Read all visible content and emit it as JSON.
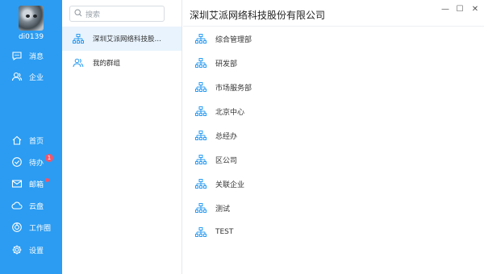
{
  "user": {
    "name": "di0139"
  },
  "nav_top": [
    {
      "label": "消息",
      "icon": "message-icon"
    },
    {
      "label": "企业",
      "icon": "contacts-icon"
    }
  ],
  "nav_bottom": [
    {
      "label": "首页",
      "icon": "home-icon"
    },
    {
      "label": "待办",
      "icon": "todo-icon",
      "badge": "1"
    },
    {
      "label": "邮箱",
      "icon": "mail-icon"
    },
    {
      "label": "云盘",
      "icon": "cloud-icon"
    },
    {
      "label": "工作圈",
      "icon": "work-circle-icon"
    },
    {
      "label": "设置",
      "icon": "settings-icon"
    }
  ],
  "search": {
    "placeholder": "搜索"
  },
  "org_list": [
    {
      "label": "深圳艾派网络科技股…",
      "active": true
    },
    {
      "label": "我的群组",
      "active": false
    }
  ],
  "main": {
    "title": "深圳艾派网络科技股份有限公司",
    "departments": [
      "综合管理部",
      "研发部",
      "市场服务部",
      "北京中心",
      "总经办",
      "区公司",
      "关联企业",
      "测试",
      "TEST"
    ]
  },
  "window_controls": {
    "minimize": "—",
    "maximize": "☐",
    "close": "✕"
  },
  "colors": {
    "sidebar": "#2b9cf2",
    "accent": "#2b9cf2",
    "badge": "#f2566b",
    "active_row": "#e8f3fd"
  }
}
